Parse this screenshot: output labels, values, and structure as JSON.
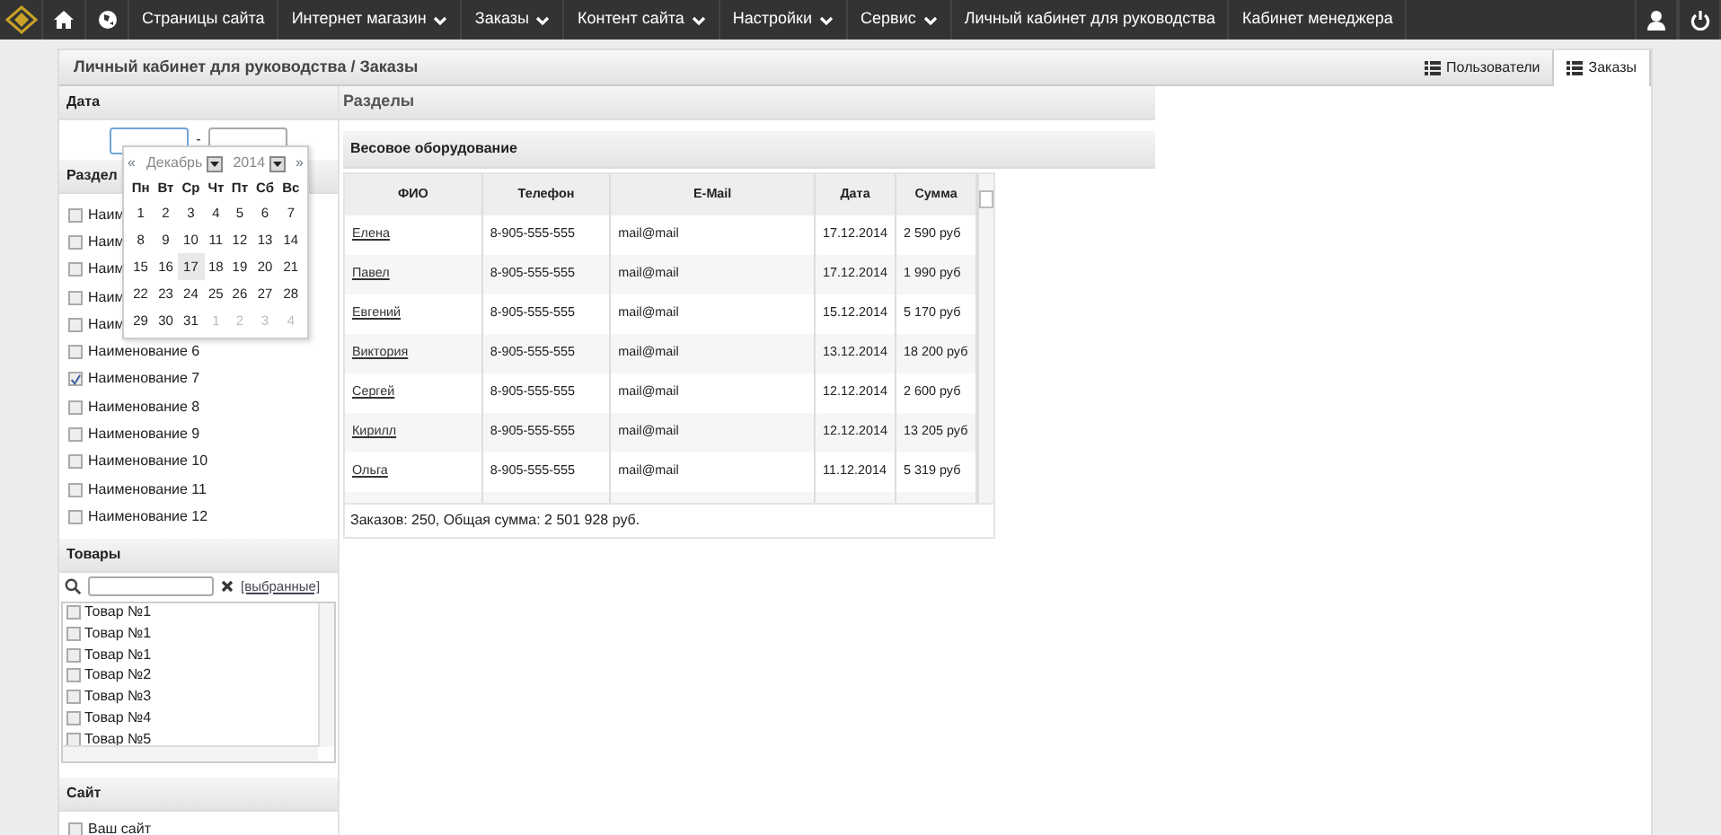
{
  "navbar": {
    "items": [
      {
        "label": "Страницы сайта",
        "dropdown": false
      },
      {
        "label": "Интернет магазин",
        "dropdown": true
      },
      {
        "label": "Заказы",
        "dropdown": true
      },
      {
        "label": "Контент сайта",
        "dropdown": true
      },
      {
        "label": "Настройки",
        "dropdown": true
      },
      {
        "label": "Сервис",
        "dropdown": true
      },
      {
        "label": "Личный кабинет для руководства",
        "dropdown": false
      },
      {
        "label": "Кабинет менеджера",
        "dropdown": false
      }
    ]
  },
  "header": {
    "title": "Личный кабинет для руководства / Заказы",
    "tabs": [
      {
        "label": "Пользователи",
        "selected": false
      },
      {
        "label": "Заказы",
        "selected": true
      }
    ]
  },
  "sidebar": {
    "date": {
      "title": "Дата",
      "separator": "-"
    },
    "calendar": {
      "prev": "«",
      "month": "Декабрь",
      "year": "2014",
      "next": "»",
      "weekdays": [
        "Пн",
        "Вт",
        "Ср",
        "Чт",
        "Пт",
        "Сб",
        "Вс"
      ],
      "weeks": [
        [
          {
            "day": "1",
            "other": false,
            "highlighted": false
          },
          {
            "day": "2",
            "other": false,
            "highlighted": false
          },
          {
            "day": "3",
            "other": false,
            "highlighted": false
          },
          {
            "day": "4",
            "other": false,
            "highlighted": false
          },
          {
            "day": "5",
            "other": false,
            "highlighted": false
          },
          {
            "day": "6",
            "other": false,
            "highlighted": false
          },
          {
            "day": "7",
            "other": false,
            "highlighted": false
          }
        ],
        [
          {
            "day": "8",
            "other": false,
            "highlighted": false
          },
          {
            "day": "9",
            "other": false,
            "highlighted": false
          },
          {
            "day": "10",
            "other": false,
            "highlighted": false
          },
          {
            "day": "11",
            "other": false,
            "highlighted": false
          },
          {
            "day": "12",
            "other": false,
            "highlighted": false
          },
          {
            "day": "13",
            "other": false,
            "highlighted": false
          },
          {
            "day": "14",
            "other": false,
            "highlighted": false
          }
        ],
        [
          {
            "day": "15",
            "other": false,
            "highlighted": false
          },
          {
            "day": "16",
            "other": false,
            "highlighted": false
          },
          {
            "day": "17",
            "other": false,
            "highlighted": true
          },
          {
            "day": "18",
            "other": false,
            "highlighted": false
          },
          {
            "day": "19",
            "other": false,
            "highlighted": false
          },
          {
            "day": "20",
            "other": false,
            "highlighted": false
          },
          {
            "day": "21",
            "other": false,
            "highlighted": false
          }
        ],
        [
          {
            "day": "22",
            "other": false,
            "highlighted": false
          },
          {
            "day": "23",
            "other": false,
            "highlighted": false
          },
          {
            "day": "24",
            "other": false,
            "highlighted": false
          },
          {
            "day": "25",
            "other": false,
            "highlighted": false
          },
          {
            "day": "26",
            "other": false,
            "highlighted": false
          },
          {
            "day": "27",
            "other": false,
            "highlighted": false
          },
          {
            "day": "28",
            "other": false,
            "highlighted": false
          }
        ],
        [
          {
            "day": "29",
            "other": false,
            "highlighted": false
          },
          {
            "day": "30",
            "other": false,
            "highlighted": false
          },
          {
            "day": "31",
            "other": false,
            "highlighted": false
          },
          {
            "day": "1",
            "other": true,
            "highlighted": false
          },
          {
            "day": "2",
            "other": true,
            "highlighted": false
          },
          {
            "day": "3",
            "other": true,
            "highlighted": false
          },
          {
            "day": "4",
            "other": true,
            "highlighted": false
          }
        ]
      ]
    },
    "sections": {
      "title": "Раздел",
      "items": [
        {
          "label": "Наим",
          "checked": false
        },
        {
          "label": "Наим",
          "checked": false
        },
        {
          "label": "Наим",
          "checked": false
        },
        {
          "label": "Наим",
          "checked": false
        },
        {
          "label": "Наим",
          "checked": false
        },
        {
          "label": "Наименование 6",
          "checked": false
        },
        {
          "label": "Наименование 7",
          "checked": true
        },
        {
          "label": "Наименование 8",
          "checked": false
        },
        {
          "label": "Наименование 9",
          "checked": false
        },
        {
          "label": "Наименование 10",
          "checked": false
        },
        {
          "label": "Наименование 11",
          "checked": false
        },
        {
          "label": "Наименование 12",
          "checked": false
        }
      ]
    },
    "products": {
      "title": "Товары",
      "selected_link": "[выбранные]",
      "items": [
        {
          "label": "Товар №1",
          "checked": false
        },
        {
          "label": "Товар №1",
          "checked": false
        },
        {
          "label": "Товар №1",
          "checked": false
        },
        {
          "label": "Товар №2",
          "checked": false
        },
        {
          "label": "Товар №3",
          "checked": false
        },
        {
          "label": "Товар №4",
          "checked": false
        },
        {
          "label": "Товар №5",
          "checked": false
        }
      ]
    },
    "site": {
      "title": "Сайт",
      "items": [
        {
          "label": "Ваш сайт",
          "checked": false
        }
      ]
    }
  },
  "main": {
    "title": "Разделы",
    "group": "Весовое оборудование",
    "table": {
      "columns": [
        "ФИО",
        "Телефон",
        "E-Mail",
        "Дата",
        "Сумма"
      ],
      "rows": [
        [
          "Елена",
          "8-905-555-555",
          "mail@mail",
          "17.12.2014",
          "2 590 руб"
        ],
        [
          "Павел",
          "8-905-555-555",
          "mail@mail",
          "17.12.2014",
          "1 990 руб"
        ],
        [
          "Евгений",
          "8-905-555-555",
          "mail@mail",
          "15.12.2014",
          "5 170 руб"
        ],
        [
          "Виктория",
          "8-905-555-555",
          "mail@mail",
          "13.12.2014",
          "18 200 руб"
        ],
        [
          "Сергей",
          "8-905-555-555",
          "mail@mail",
          "12.12.2014",
          "2 600 руб"
        ],
        [
          "Кирилл",
          "8-905-555-555",
          "mail@mail",
          "12.12.2014",
          "13 205 руб"
        ],
        [
          "Ольга",
          "8-905-555-555",
          "mail@mail",
          "11.12.2014",
          "5 319 руб"
        ]
      ]
    },
    "summary": "Заказов: 250, Общая сумма: 2 501 928 руб."
  }
}
